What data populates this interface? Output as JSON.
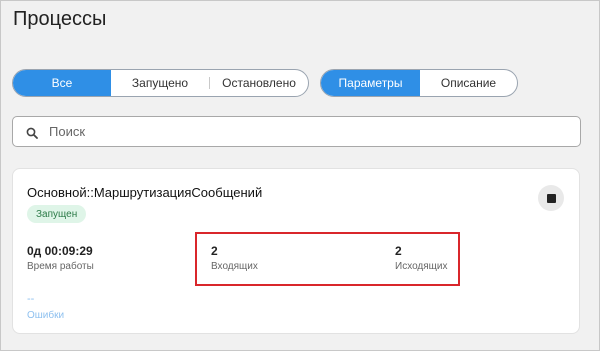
{
  "page": {
    "title": "Процессы"
  },
  "filters": {
    "status_tabs": [
      "Все",
      "Запущено",
      "Остановлено"
    ],
    "view_tabs": [
      "Параметры",
      "Описание"
    ]
  },
  "search": {
    "placeholder": "Поиск",
    "value": ""
  },
  "process": {
    "name": "Основной::МаршрутизацияСообщений",
    "status": "Запущен",
    "uptime_value": "0д 00:09:29",
    "uptime_label": "Время работы",
    "incoming_value": "2",
    "incoming_label": "Входящих",
    "outgoing_value": "2",
    "outgoing_label": "Исходящих",
    "errors_value": "--",
    "errors_label": "Ошибки"
  },
  "colors": {
    "accent": "#2f8fe6",
    "status_bg": "#dff5e8",
    "status_text": "#2b7a47",
    "highlight": "#d9262b"
  }
}
